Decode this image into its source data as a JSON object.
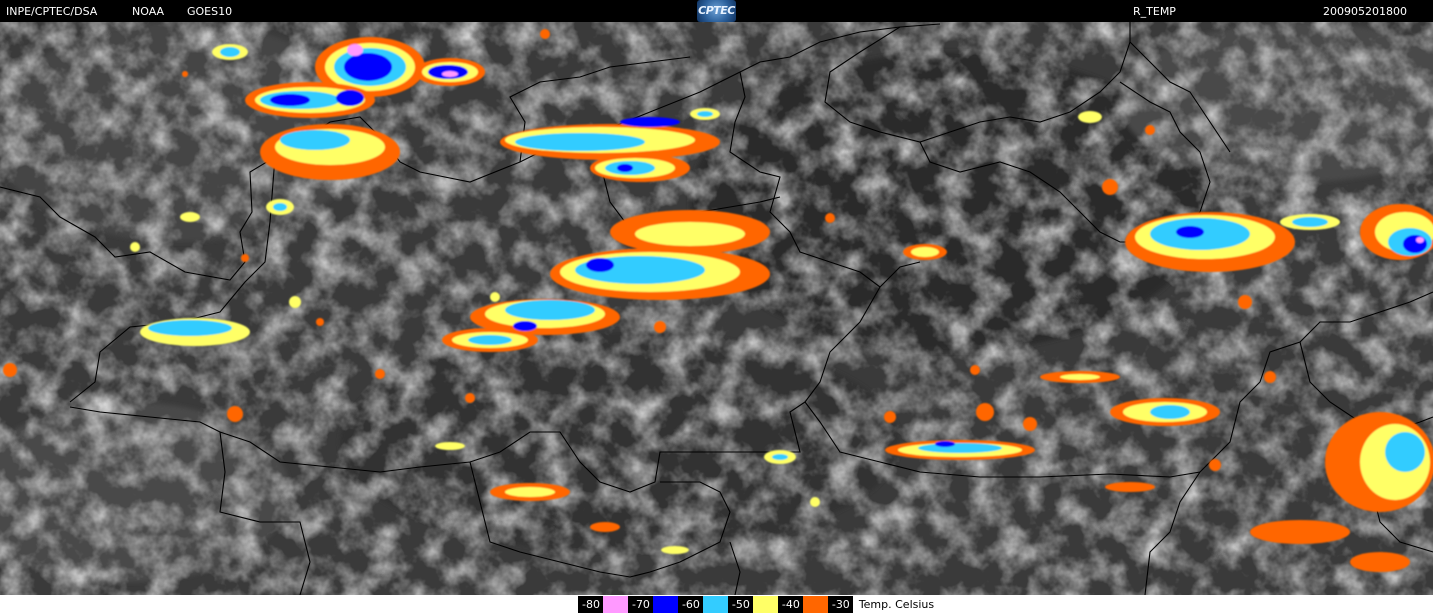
{
  "header": {
    "agency": "INPE/CPTEC/DSA",
    "operator": "NOAA",
    "satellite": "GOES10",
    "logo_text": "CPTEC",
    "product": "R_TEMP",
    "timestamp": "200905201800"
  },
  "legend": {
    "title": "Temp. Celsius",
    "items": [
      {
        "label": "-80",
        "color": "#ff99ff"
      },
      {
        "label": "-70",
        "color": "#0000ff"
      },
      {
        "label": "-60",
        "color": "#00ccff"
      },
      {
        "label": "-50",
        "color": "#ffff66"
      },
      {
        "label": "-40",
        "color": "#ff6600"
      },
      {
        "label": "-30",
        "color": ""
      }
    ]
  },
  "colors": {
    "background": "#3c3c3c",
    "border_lines": "#000000",
    "cold_very": "#ff99ff",
    "cold_blue": "#0000ff",
    "cold_cyan": "#33ccff",
    "cold_yellow": "#ffff66",
    "cold_orange": "#ff6600"
  }
}
